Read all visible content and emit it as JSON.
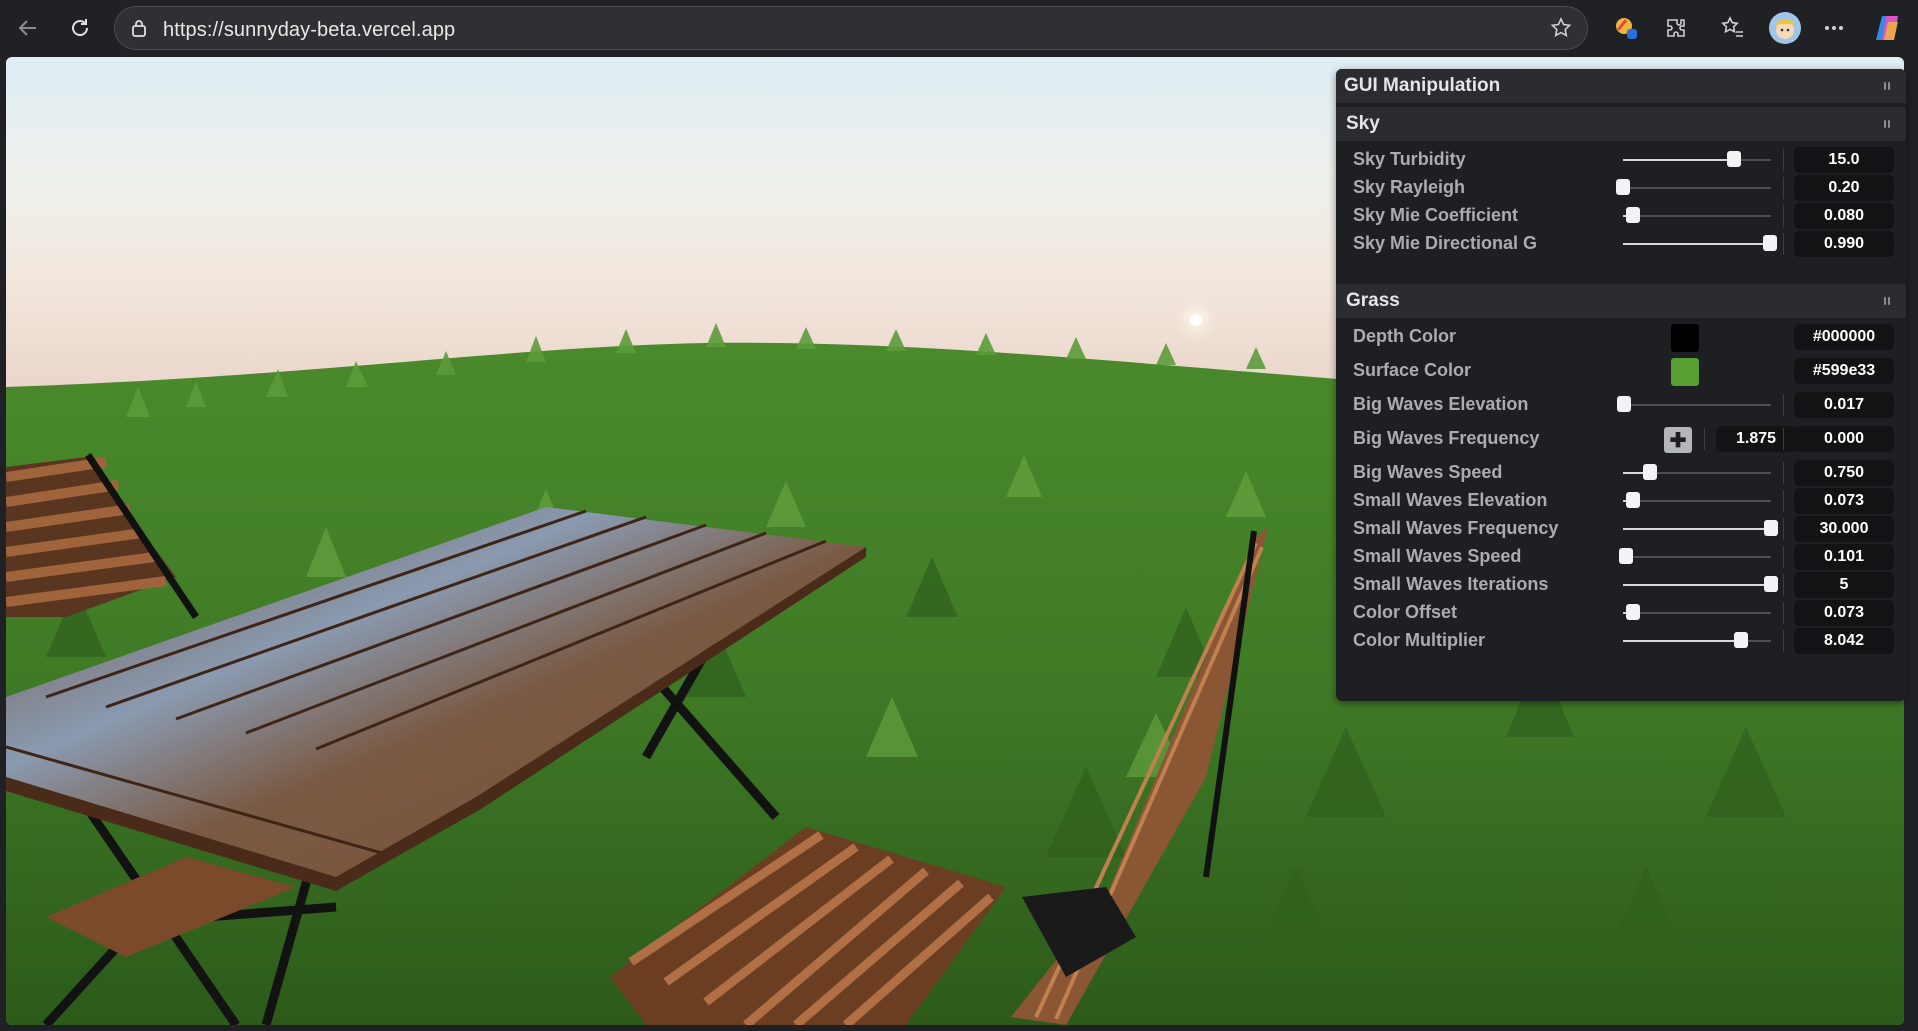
{
  "browser": {
    "url": "https://sunnyday-beta.vercel.app",
    "icons": [
      "back-icon",
      "refresh-icon",
      "lock-icon",
      "favorite-star-icon",
      "extension-color-icon",
      "extensions-puzzle-icon",
      "favorites-icon",
      "profile-avatar-icon",
      "more-icon",
      "copilot-icon"
    ]
  },
  "gui": {
    "title": "GUI Manipulation",
    "sky": {
      "title": "Sky",
      "rows": [
        {
          "label": "Sky Turbidity",
          "value": "15.0",
          "level": 0.75
        },
        {
          "label": "Sky Rayleigh",
          "value": "0.20",
          "level": 0.0
        },
        {
          "label": "Sky Mie Coefficient",
          "value": "0.080",
          "level": 0.07
        },
        {
          "label": "Sky Mie Directional G",
          "value": "0.990",
          "level": 0.99
        }
      ]
    },
    "grass": {
      "title": "Grass",
      "depth_color": {
        "label": "Depth Color",
        "value": "#000000"
      },
      "surface_color": {
        "label": "Surface Color",
        "value": "#599e33"
      },
      "big_waves_elevation": {
        "label": "Big Waves Elevation",
        "value": "0.017",
        "level": 0.01
      },
      "big_waves_frequency": {
        "label": "Big Waves Frequency",
        "x": "1.875",
        "y": "0.000"
      },
      "rows": [
        {
          "label": "Big Waves Speed",
          "value": "0.750",
          "level": 0.18
        },
        {
          "label": "Small Waves Elevation",
          "value": "0.073",
          "level": 0.07
        },
        {
          "label": "Small Waves Frequency",
          "value": "30.000",
          "level": 1.0
        },
        {
          "label": "Small Waves Speed",
          "value": "0.101",
          "level": 0.02
        },
        {
          "label": "Small Waves Iterations",
          "value": "5",
          "level": 1.0
        },
        {
          "label": "Color Offset",
          "value": "0.073",
          "level": 0.07
        },
        {
          "label": "Color Multiplier",
          "value": "8.042",
          "level": 0.8
        }
      ]
    }
  }
}
